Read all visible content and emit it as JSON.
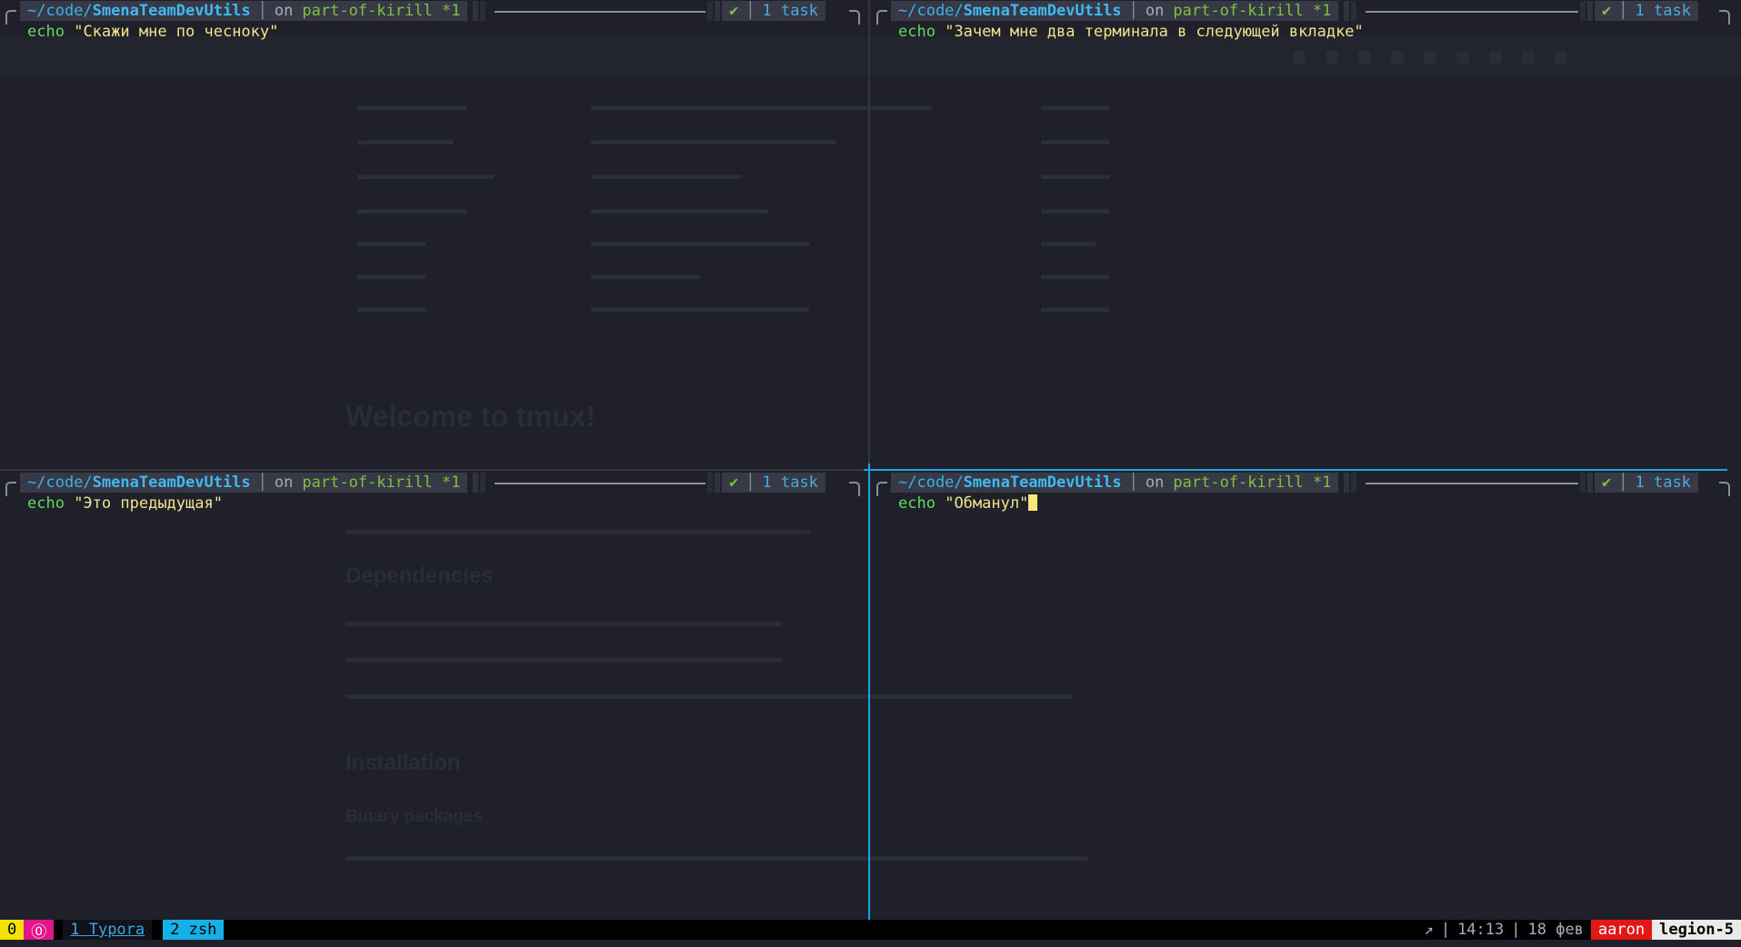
{
  "colors": {
    "background": "#1f2029",
    "directory": "#40b8f0",
    "branch": "#7ec23c",
    "echo_keyword": "#62d960",
    "string": "#f0e48a",
    "active_border": "#1ba3e6",
    "inactive_border": "#33353f",
    "cursor": "#f5e87a"
  },
  "panes": [
    {
      "id": "top-left",
      "prompt": {
        "dir_prefix": "~/code/",
        "dir_name": "SmenaTeamDevUtils",
        "on": "on",
        "branch": "part-of-kirill *1",
        "status_icon": "check-icon",
        "status_glyph": "✔",
        "tasks": "1 task"
      },
      "command": {
        "keyword": "echo",
        "argument": "\"Скажи мне по чесноку\""
      },
      "active": false
    },
    {
      "id": "top-right",
      "prompt": {
        "dir_prefix": "~/code/",
        "dir_name": "SmenaTeamDevUtils",
        "on": "on",
        "branch": "part-of-kirill *1",
        "status_icon": "check-icon",
        "status_glyph": "✔",
        "tasks": "1 task"
      },
      "command": {
        "keyword": "echo",
        "argument": "\"Зачем мне два терминала в следующей вкладке\""
      },
      "active": false
    },
    {
      "id": "bottom-left",
      "prompt": {
        "dir_prefix": "~/code/",
        "dir_name": "SmenaTeamDevUtils",
        "on": "on",
        "branch": "part-of-kirill *1",
        "status_icon": "check-icon",
        "status_glyph": "✔",
        "tasks": "1 task"
      },
      "command": {
        "keyword": "echo",
        "argument": "\"Это предыдущая\""
      },
      "active": false
    },
    {
      "id": "bottom-right",
      "prompt": {
        "dir_prefix": "~/code/",
        "dir_name": "SmenaTeamDevUtils",
        "on": "on",
        "branch": "part-of-kirill *1",
        "status_icon": "check-icon",
        "status_glyph": "✔",
        "tasks": "1 task"
      },
      "command": {
        "keyword": "echo",
        "argument": "\"Обманул\""
      },
      "active": true
    }
  ],
  "statusbar": {
    "session": "0",
    "zoom_glyph": "⓪",
    "windows": [
      {
        "label": "1 Typora",
        "active": false
      },
      {
        "label": "2 zsh",
        "active": true
      }
    ],
    "arrow_glyph": "↗",
    "separator": "|",
    "time": "14:13",
    "date": "18 фев",
    "user": "aaron",
    "host": "legion-5"
  },
  "background_app": {
    "heading": "Welcome to tmux!",
    "sections": [
      "Dependencies",
      "Installation",
      "Binary packages"
    ]
  }
}
